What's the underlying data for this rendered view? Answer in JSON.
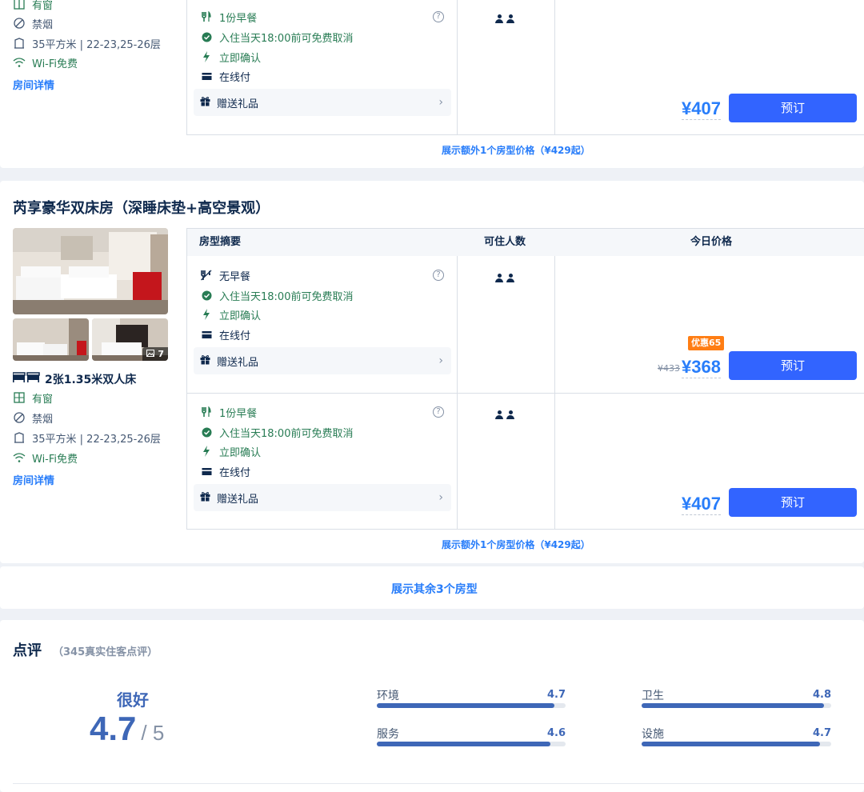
{
  "top_room": {
    "features": [
      {
        "icon": "window-icon",
        "text": "有窗"
      },
      {
        "icon": "no-smoking-icon",
        "text": "禁烟"
      },
      {
        "icon": "floor-area-icon",
        "text": "35平方米 | 22-23,25-26层"
      },
      {
        "icon": "wifi-icon",
        "text": "Wi-Fi免费"
      }
    ],
    "details_link": "房间详情",
    "offer": {
      "meal": "1份早餐",
      "cancel": "入住当天18:00前可免费取消",
      "confirm": "立即确认",
      "pay": "在线付",
      "gift": "赠送礼品",
      "price": "¥407",
      "book": "预订"
    },
    "more_link": "展示额外1个房型价格（¥429起）"
  },
  "room2": {
    "title": "芮享豪华双床房（深睡床垫+高空景观）",
    "photo_count": "7",
    "bed": "2张1.35米双人床",
    "features": [
      {
        "icon": "window-icon",
        "text": "有窗"
      },
      {
        "icon": "no-smoking-icon",
        "text": "禁烟"
      },
      {
        "icon": "floor-area-icon",
        "text": "35平方米 | 22-23,25-26层"
      },
      {
        "icon": "wifi-icon",
        "text": "Wi-Fi免费"
      }
    ],
    "details_link": "房间详情",
    "table_headers": {
      "summary": "房型摘要",
      "occupancy": "可住人数",
      "price": "今日价格"
    },
    "offers": [
      {
        "meal": "无早餐",
        "cancel": "入住当天18:00前可免费取消",
        "confirm": "立即确认",
        "pay": "在线付",
        "gift": "赠送礼品",
        "discount_badge": "优惠65",
        "original_price": "¥433",
        "price": "¥368",
        "book": "预订"
      },
      {
        "meal": "1份早餐",
        "cancel": "入住当天18:00前可免费取消",
        "confirm": "立即确认",
        "pay": "在线付",
        "gift": "赠送礼品",
        "price": "¥407",
        "book": "预订"
      }
    ],
    "more_link": "展示额外1个房型价格（¥429起）"
  },
  "show_more_rooms": "展示其余3个房型",
  "reviews": {
    "title": "点评",
    "count_text": "（345真实住客点评）",
    "overall_label": "很好",
    "overall_score": "4.7",
    "score_max": "/ 5",
    "categories": [
      {
        "label": "环境",
        "score": "4.7",
        "fraction": 0.94
      },
      {
        "label": "卫生",
        "score": "4.8",
        "fraction": 0.96
      },
      {
        "label": "服务",
        "score": "4.6",
        "fraction": 0.92
      },
      {
        "label": "设施",
        "score": "4.7",
        "fraction": 0.94
      }
    ]
  }
}
